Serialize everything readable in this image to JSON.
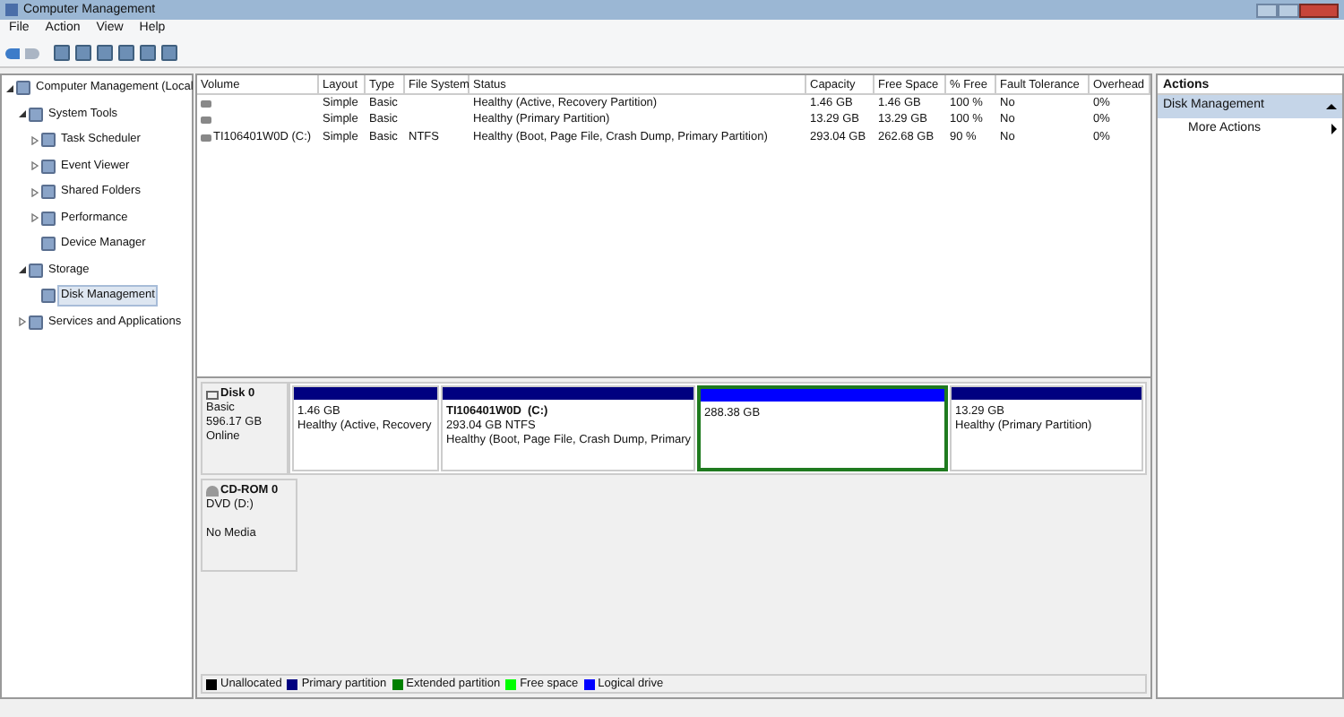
{
  "window": {
    "title": "Computer Management"
  },
  "menu": [
    "File",
    "Action",
    "View",
    "Help"
  ],
  "tree": [
    {
      "label": "Computer Management (Local",
      "expanded": true,
      "selected": false,
      "children": [
        {
          "label": "System Tools",
          "expanded": true,
          "selected": false,
          "children": [
            {
              "label": "Task Scheduler",
              "expanded": false,
              "selected": false
            },
            {
              "label": "Event Viewer",
              "expanded": false,
              "selected": false
            },
            {
              "label": "Shared Folders",
              "expanded": false,
              "selected": false
            },
            {
              "label": "Performance",
              "expanded": false,
              "selected": false
            },
            {
              "label": "Device Manager",
              "selected": false
            }
          ]
        },
        {
          "label": "Storage",
          "expanded": true,
          "selected": false,
          "children": [
            {
              "label": "Disk Management",
              "selected": true
            }
          ]
        },
        {
          "label": "Services and Applications",
          "expanded": false,
          "selected": false
        }
      ]
    }
  ],
  "table": {
    "columns": [
      "Volume",
      "Layout",
      "Type",
      "File System",
      "Status",
      "Capacity",
      "Free Space",
      "% Free",
      "Fault Tolerance",
      "Overhead"
    ],
    "rows": [
      [
        "",
        "Simple",
        "Basic",
        "",
        "Healthy (Active, Recovery Partition)",
        "1.46 GB",
        "1.46 GB",
        "100 %",
        "No",
        "0%"
      ],
      [
        "",
        "Simple",
        "Basic",
        "",
        "Healthy (Primary Partition)",
        "13.29 GB",
        "13.29 GB",
        "100 %",
        "No",
        "0%"
      ],
      [
        "TI106401W0D (C:)",
        "Simple",
        "Basic",
        "NTFS",
        "Healthy (Boot, Page File, Crash Dump, Primary Partition)",
        "293.04 GB",
        "262.68 GB",
        "90 %",
        "No",
        "0%"
      ]
    ]
  },
  "disks": [
    {
      "name": "Disk 0",
      "kind": "disk",
      "lines": [
        "Basic",
        "596.17 GB",
        "Online"
      ],
      "partitions": [
        {
          "lines": [
            "1.46 GB",
            "Healthy (Active, Recovery"
          ],
          "color": "#000080",
          "selected": false
        },
        {
          "title": "TI106401W0D  (C:)",
          "lines": [
            "293.04 GB NTFS",
            "Healthy (Boot, Page File, Crash Dump, Primary"
          ],
          "color": "#000080",
          "selected": false
        },
        {
          "lines": [
            "288.38 GB"
          ],
          "color": "#0000ff",
          "selected": true
        },
        {
          "lines": [
            "13.29 GB",
            "Healthy (Primary Partition)"
          ],
          "color": "#000080",
          "selected": false
        }
      ]
    },
    {
      "name": "CD-ROM 0",
      "kind": "cdrom",
      "lines": [
        "DVD (D:)",
        "No Media"
      ]
    }
  ],
  "legend": [
    {
      "label": "Unallocated",
      "color": "#000000"
    },
    {
      "label": "Primary partition",
      "color": "#000080"
    },
    {
      "label": "Extended partition",
      "color": "#008000"
    },
    {
      "label": "Free space",
      "color": "#00ff00"
    },
    {
      "label": "Logical drive",
      "color": "#0000ff"
    }
  ],
  "actions": {
    "title": "Actions",
    "section": "Disk Management",
    "items": [
      "More Actions"
    ]
  }
}
